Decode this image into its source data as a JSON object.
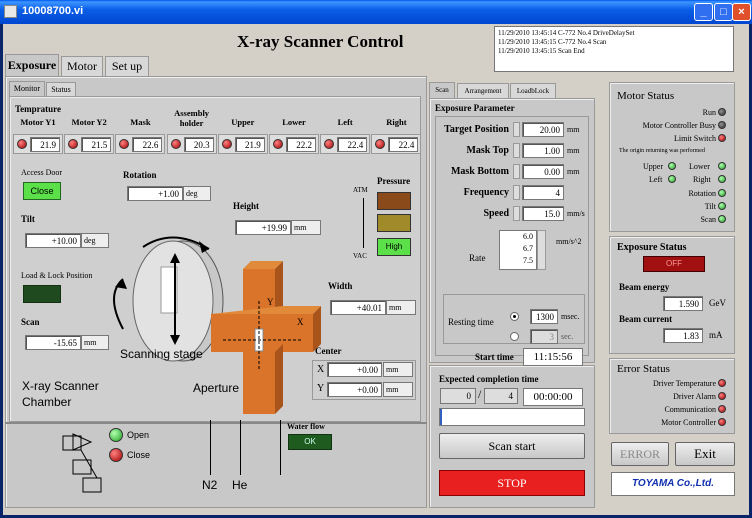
{
  "window": {
    "title": "10008700.vi"
  },
  "app": {
    "title": "X-ray Scanner Control"
  },
  "log": [
    "11/29/2010 13:45:14 C-772 No.4 DriveDelaySet",
    "11/29/2010 13:45:15 C-772 No.4 Scan",
    "11/29/2010 13:45:15 Scan End"
  ],
  "main_tabs": [
    "Exposure",
    "Motor",
    "Set up"
  ],
  "sub_tabs": [
    "Monitor",
    "Status"
  ],
  "temperature": {
    "heading": "Temprature",
    "columns": [
      {
        "label": "Motor Y1",
        "value": "21.9"
      },
      {
        "label": "Motor Y2",
        "value": "21.5"
      },
      {
        "label": "Mask",
        "value": "22.6"
      },
      {
        "label": "Assembly holder",
        "value": "20.3"
      },
      {
        "label": "Upper",
        "value": "21.9"
      },
      {
        "label": "Lower",
        "value": "22.2"
      },
      {
        "label": "Left",
        "value": "22.4"
      },
      {
        "label": "Right",
        "value": "22.4"
      }
    ]
  },
  "access_door": {
    "label": "Access Door",
    "state": "Close"
  },
  "rotation": {
    "label": "Rotation",
    "value": "+1.00",
    "unit": "deg"
  },
  "tilt": {
    "label": "Tilt",
    "value": "+10.00",
    "unit": "deg"
  },
  "height": {
    "label": "Height",
    "value": "+19.99",
    "unit": "mm"
  },
  "load_lock": {
    "label": "Load & Lock Position"
  },
  "scan_pos": {
    "label": "Scan",
    "value": "-15.65",
    "unit": "mm"
  },
  "width": {
    "label": "Width",
    "value": "+40.01",
    "unit": "mm"
  },
  "center": {
    "label": "Center",
    "x_label": "X",
    "x_value": "+0.00",
    "y_label": "Y",
    "y_value": "+0.00",
    "unit": "mm"
  },
  "pressure": {
    "label": "Pressure",
    "atm": "ATM",
    "vac": "VAC",
    "state": "High"
  },
  "diagram": {
    "scanning_stage": "Scanning stage",
    "aperture": "Aperture",
    "chamber": "X-ray Scanner\nChamber",
    "n2": "N2",
    "he": "He",
    "water_flow": "Water flow",
    "water_state": "OK",
    "open": "Open",
    "close": "Close",
    "x": "X",
    "y": "Y"
  },
  "scan_tabs": [
    "Scan",
    "Arrangement",
    "LoadbLock"
  ],
  "exposure_param": {
    "heading": "Exposure Parameter",
    "rows": [
      {
        "label": "Target Position",
        "value": "20.00",
        "unit": "mm"
      },
      {
        "label": "Mask Top",
        "value": "1.00",
        "unit": "mm"
      },
      {
        "label": "Mask Bottom",
        "value": "0.00",
        "unit": "mm"
      },
      {
        "label": "Frequency",
        "value": "4",
        "unit": ""
      },
      {
        "label": "Speed",
        "value": "15.0",
        "unit": "mm/s"
      }
    ],
    "rate_label": "Rate",
    "rate_values": [
      "6.0",
      "6.7",
      "7.5"
    ],
    "rate_unit": "mm/s^2",
    "resting_label": "Resting time",
    "rest_msec": "1300",
    "rest_msec_unit": "msec.",
    "rest_sec": "3",
    "rest_sec_unit": "sec."
  },
  "timing": {
    "start_label": "Start time",
    "start_value": "11:15:56",
    "completion_label": "Expected completion time",
    "count": "0",
    "slash": "/",
    "total": "4",
    "completion_value": "00:00:00"
  },
  "scan_start": "Scan start",
  "stop": "STOP",
  "motor_status": {
    "heading": "Motor Status",
    "items": [
      "Run",
      "Motor Controller Busy",
      "Limit Switch"
    ],
    "note": "The origin returning was performed",
    "dirs": [
      [
        "Upper",
        "Lower"
      ],
      [
        "Left",
        "Right"
      ]
    ],
    "singles": [
      "Rotation",
      "Tilt",
      "Scan"
    ]
  },
  "exposure_status": {
    "heading": "Exposure Status",
    "state": "OFF",
    "beam_energy_label": "Beam energy",
    "beam_energy": "1.590",
    "beam_energy_unit": "GeV",
    "beam_current_label": "Beam current",
    "beam_current": "1.83",
    "beam_current_unit": "mA"
  },
  "error_status": {
    "heading": "Error Status",
    "items": [
      "Driver Temperature",
      "Driver Alarm",
      "Communication",
      "Motor Controller"
    ]
  },
  "error_btn": "ERROR",
  "exit_btn": "Exit",
  "logo": "TOYAMA Co.,Ltd."
}
